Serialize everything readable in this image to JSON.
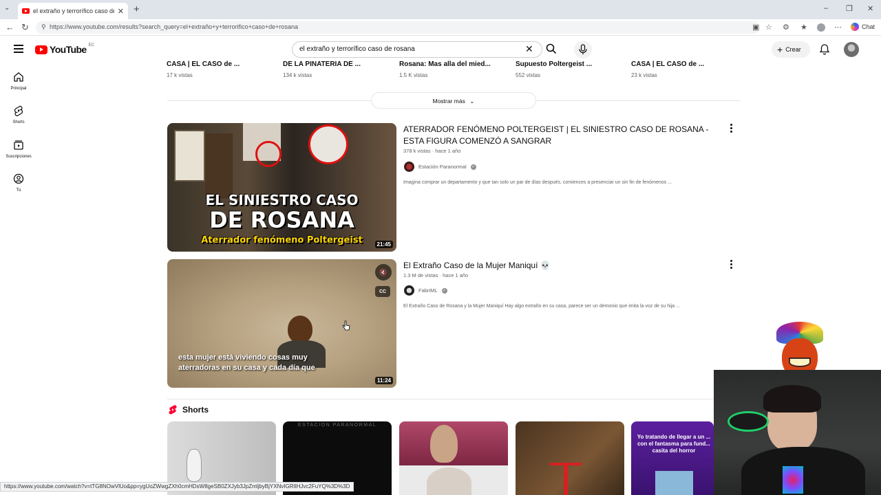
{
  "browser": {
    "tab_title": "el extraño y terrorífico caso de ros",
    "url": "https://www.youtube.com/results?search_query=el+extraño+y+terrorifico+caso+de+rosana",
    "chat_label": "Chat",
    "status_url": "https://www.youtube.com/watch?v=tTG8NOwVlUo&pp=ygUoZWwgZXh0cmHDsW8geSB0ZXJyb3JpZmljbyBjYXNvIGRlIHJvc2FuYQ%3D%3D"
  },
  "youtube": {
    "logo_text": "YouTube",
    "country_code": "EC",
    "search_value": "el extraño y terrorífico caso de rosana",
    "create_label": "Crear"
  },
  "sidebar": {
    "items": [
      {
        "label": "Principal",
        "icon": "home-icon"
      },
      {
        "label": "Shorts",
        "icon": "shorts-icon"
      },
      {
        "label": "Suscripciones",
        "icon": "subscriptions-icon"
      },
      {
        "label": "Tú",
        "icon": "you-icon"
      }
    ]
  },
  "top_results": [
    {
      "title": "CASA | EL CASO de ...",
      "views": "17 k vistas"
    },
    {
      "title": "DE LA PINATERIA DE ...",
      "views": "134 k vistas"
    },
    {
      "title": "Rosana: Mas alla del mied...",
      "views": "1.5 K vistas"
    },
    {
      "title": "Supuesto Poltergeist ...",
      "views": "552 vistas"
    },
    {
      "title": "CASA | EL CASO de ...",
      "views": "23 k vistas"
    }
  ],
  "show_more_label": "Mostrar más",
  "videos": [
    {
      "title": "ATERRADOR FENÓMENO POLTERGEIST | EL SINIESTRO CASO DE ROSANA - ESTA FIGURA COMENZÓ A SANGRAR",
      "meta": "378 k vistas · hace 1 año",
      "channel": "Estación Paranormal",
      "description": "Imagina comprar un departamento y que tan solo un par de días después, comiences a presenciar un sin fin de fenómenos ...",
      "duration": "21:45",
      "thumb_line1": "EL SINIESTRO CASO",
      "thumb_line2": "DE ROSANA",
      "thumb_line3": "Aterrador fenómeno Poltergeist"
    },
    {
      "title": "El Extraño Caso de la Mujer Maniquí 💀",
      "meta": "1.3 M de vistas · hace 1 año",
      "channel": "FabriML",
      "description": "El Extraño Caso de Rosana y la Mujer Maniquí Hay algo extraño en su casa, parece ser un demonio que imita la voz de su hija ...",
      "duration": "11:24",
      "caption": "esta mujer está viviendo cosas muy aterradoras en su casa y cada día que",
      "cc_label": "CC"
    }
  ],
  "shorts": {
    "heading": "Shorts",
    "items": [
      {
        "overlay": ""
      },
      {
        "overlay": "ESTACION PARANORMAL"
      },
      {
        "overlay": ""
      },
      {
        "overlay": ""
      },
      {
        "overlay": "Yo tratando de llegar a un ... con el fantasma para fund... casita del horror"
      }
    ]
  },
  "colors": {
    "youtube_red": "#ff0000",
    "thumb1_yellow": "#ffd600",
    "shorts_red": "#ff0033"
  }
}
